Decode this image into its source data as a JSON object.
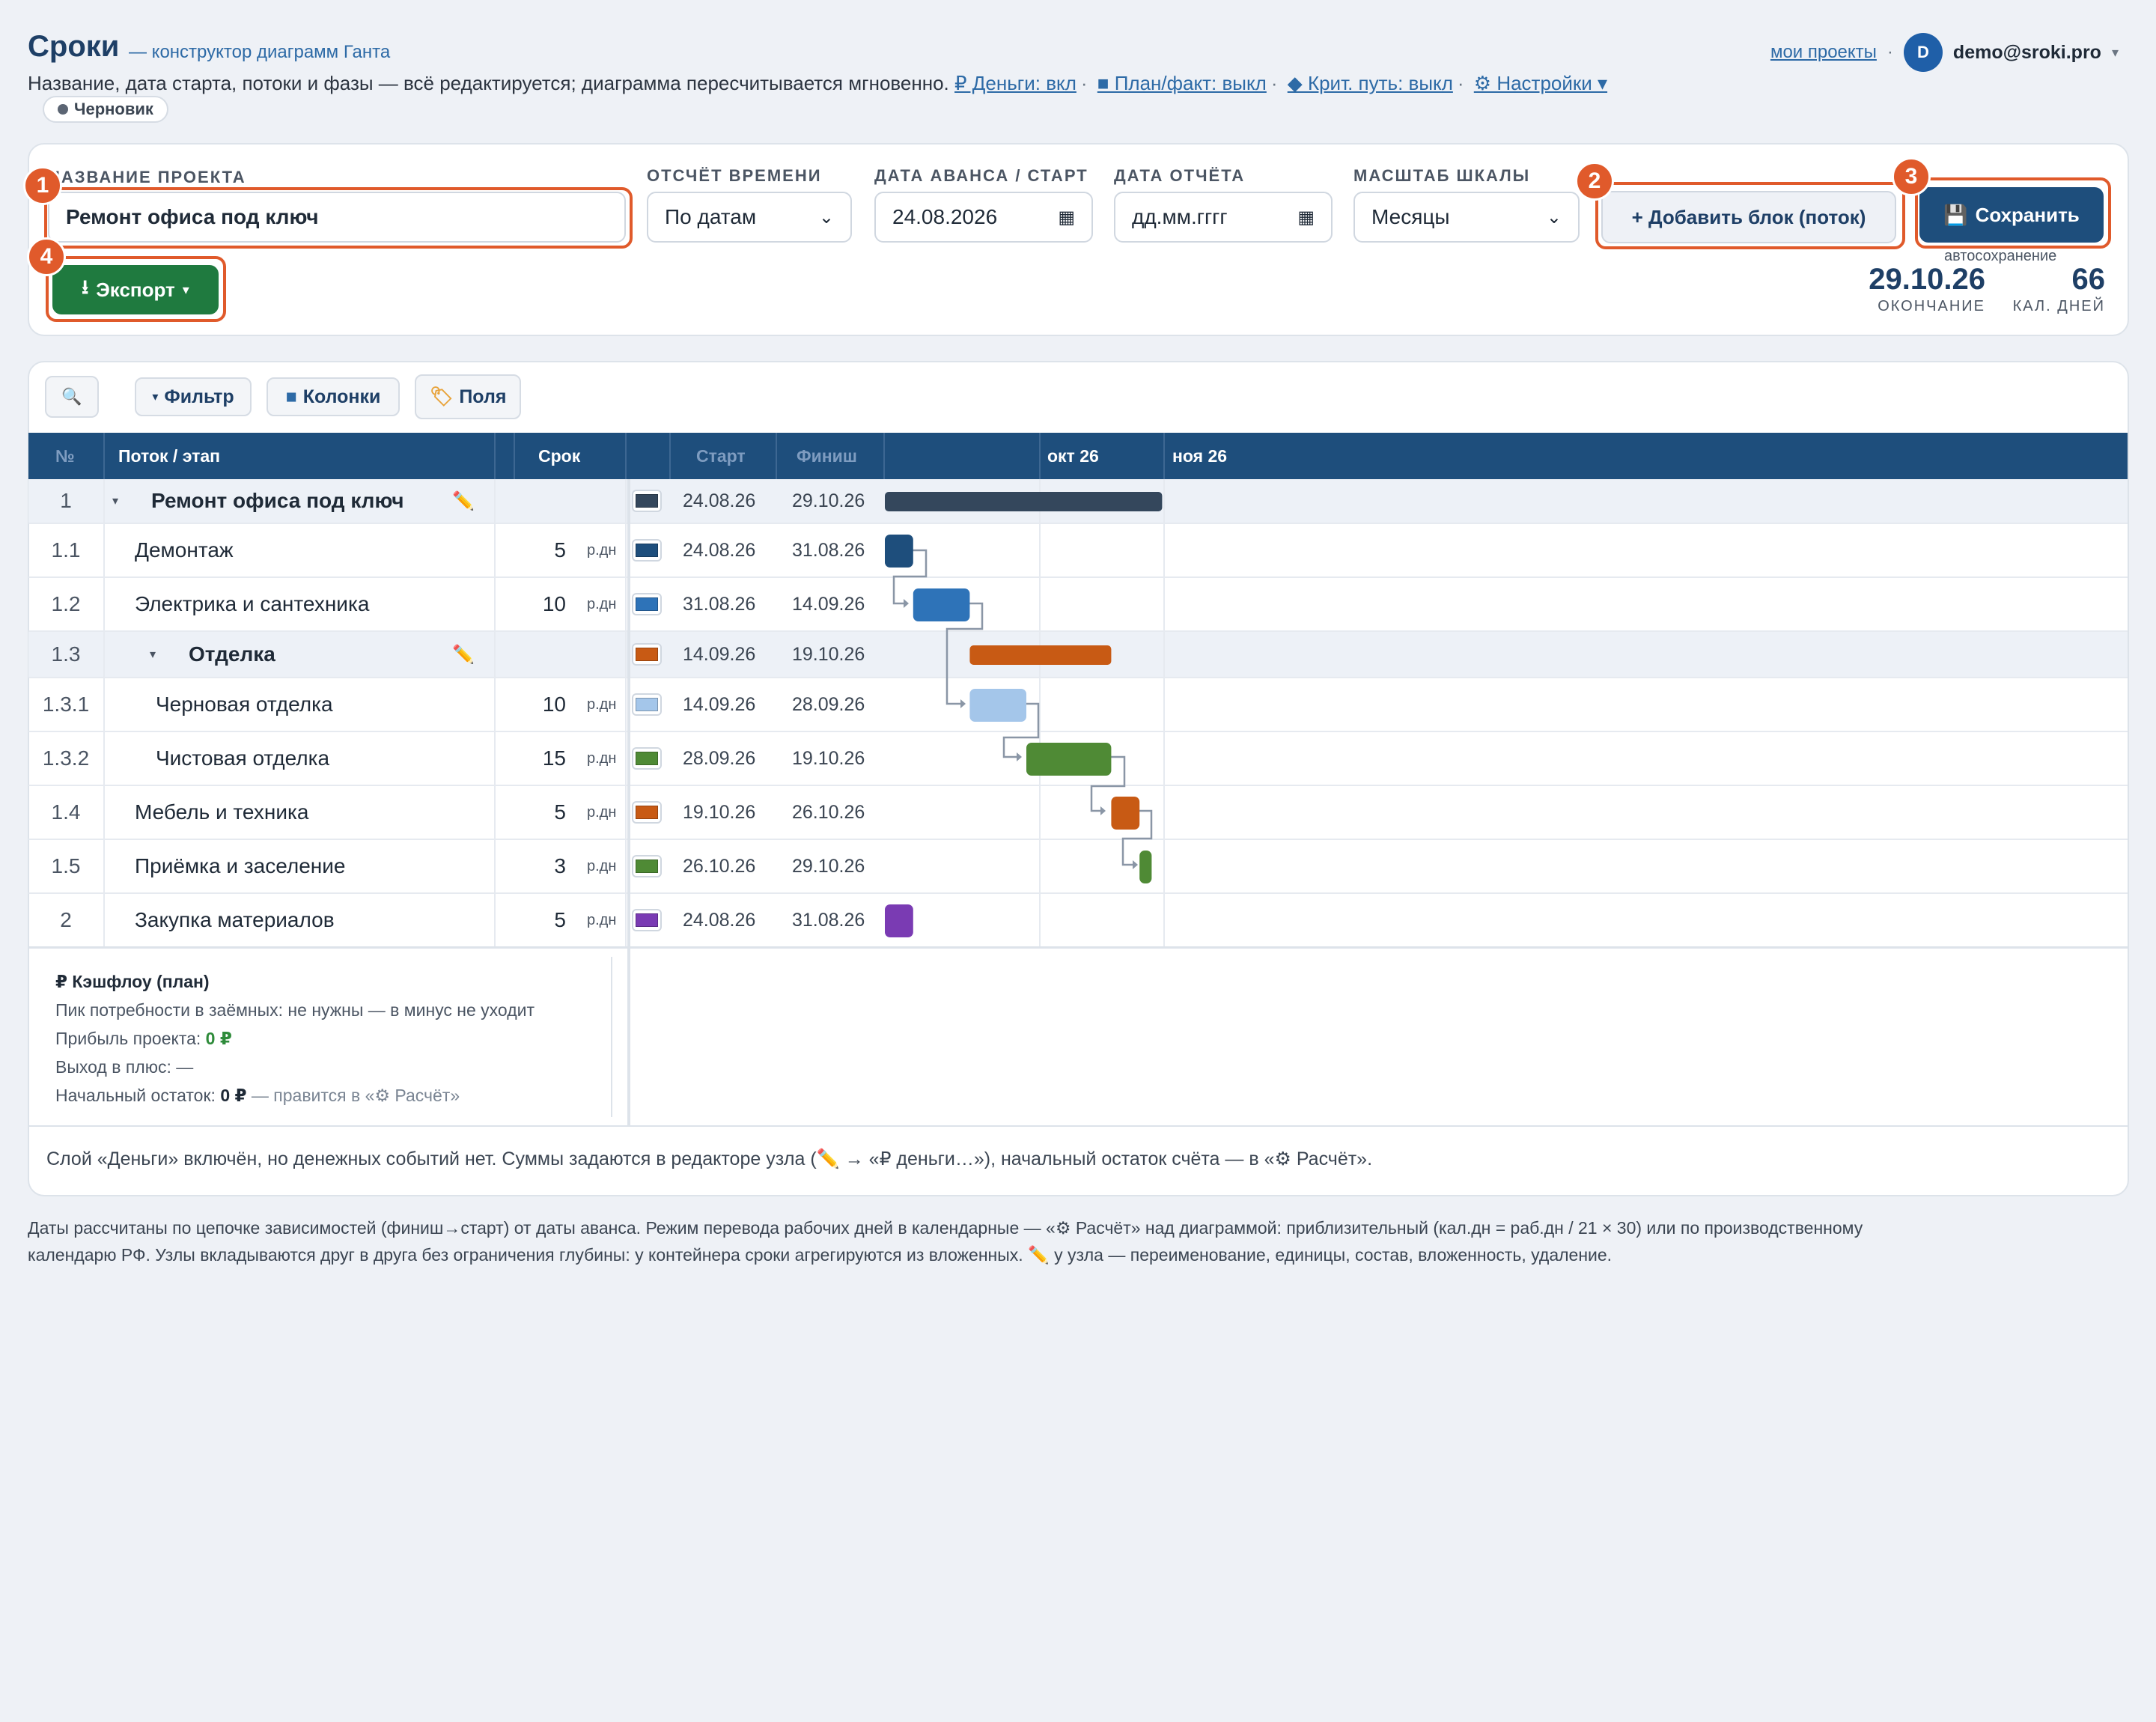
{
  "header": {
    "title": "Сроки",
    "subtitle": "— конструктор диаграмм Ганта",
    "description": "Название, дата старта, потоки и фазы — всё редактируется; диаграмма пересчитывается мгновенно.",
    "toggles": [
      "₽ Деньги: вкл",
      "■ План/факт: выкл",
      "◆ Крит. путь: выкл",
      "⚙ Настройки ▾"
    ],
    "status": "Черновик",
    "my_projects": "мои проекты",
    "avatar_letter": "D",
    "email": "demo@sroki.pro"
  },
  "controls": {
    "project_name_label": "НАЗВАНИЕ ПРОЕКТА",
    "project_name": "Ремонт офиса под ключ",
    "time_label": "ОТСЧЁТ ВРЕМЕНИ",
    "time_value": "По датам",
    "start_label": "ДАТА АВАНСА / СТАРТ",
    "start_value": "24.08.2026",
    "report_label": "ДАТА ОТЧЁТА",
    "report_value": "дд.мм.гггг",
    "scale_label": "МАСШТАБ ШКАЛЫ",
    "scale_value": "Месяцы",
    "add_block": "+ Добавить блок (поток)",
    "save": "Сохранить",
    "autosave": "автосохранение",
    "export": "Экспорт",
    "end_date": "29.10.26",
    "end_label": "ОКОНЧАНИЕ",
    "days": "66",
    "days_label": "КАЛ. ДНЕЙ"
  },
  "toolbar": {
    "filter": "Фильтр",
    "columns": "Колонки",
    "fields": "Поля"
  },
  "table": {
    "headers": {
      "num": "№",
      "name": "Поток / этап",
      "duration": "Срок",
      "start": "Старт",
      "finish": "Финиш",
      "month1": "окт 26",
      "month2": "ноя 26"
    },
    "rows": [
      {
        "num": "1",
        "name": "Ремонт офиса под ключ",
        "dur": "",
        "unit": "",
        "start": "24.08.26",
        "finish": "29.10.26",
        "color": "#34475c"
      },
      {
        "num": "1.1",
        "name": "Демонтаж",
        "dur": "5",
        "unit": "р.дн",
        "start": "24.08.26",
        "finish": "31.08.26",
        "color": "#1e4e7c"
      },
      {
        "num": "1.2",
        "name": "Электрика и сантехника",
        "dur": "10",
        "unit": "р.дн",
        "start": "31.08.26",
        "finish": "14.09.26",
        "color": "#2e73b8"
      },
      {
        "num": "1.3",
        "name": "Отделка",
        "dur": "",
        "unit": "",
        "start": "14.09.26",
        "finish": "19.10.26",
        "color": "#c85a14"
      },
      {
        "num": "1.3.1",
        "name": "Черновая отделка",
        "dur": "10",
        "unit": "р.дн",
        "start": "14.09.26",
        "finish": "28.09.26",
        "color": "#a4c6ea"
      },
      {
        "num": "1.3.2",
        "name": "Чистовая отделка",
        "dur": "15",
        "unit": "р.дн",
        "start": "28.09.26",
        "finish": "19.10.26",
        "color": "#4f8a35"
      },
      {
        "num": "1.4",
        "name": "Мебель и техника",
        "dur": "5",
        "unit": "р.дн",
        "start": "19.10.26",
        "finish": "26.10.26",
        "color": "#c85a14"
      },
      {
        "num": "1.5",
        "name": "Приёмка и заселение",
        "dur": "3",
        "unit": "р.дн",
        "start": "26.10.26",
        "finish": "29.10.26",
        "color": "#4f8a35"
      },
      {
        "num": "2",
        "name": "Закупка материалов",
        "dur": "5",
        "unit": "р.дн",
        "start": "24.08.26",
        "finish": "31.08.26",
        "color": "#7a3bb3"
      }
    ]
  },
  "cashflow": {
    "title": "₽ Кэшфлоу (план)",
    "peak": "Пик потребности в заёмных: не нужны — в минус не уходит",
    "profit_label": "Прибыль проекта:",
    "profit_value": "0 ₽",
    "breakeven": "Выход в плюс: —",
    "balance_label": "Начальный остаток:",
    "balance_value": "0 ₽",
    "balance_note": "— правится в «⚙ Расчёт»"
  },
  "money_note": "Слой «Деньги» включён, но денежных событий нет. Суммы задаются в редакторе узла (✏️ → «₽ деньги…»), начальный остаток счёта — в «⚙ Расчёт».",
  "footer_line1": "Даты рассчитаны по цепочке зависимостей (финиш→старт) от даты аванса. Режим перевода рабочих дней в календарные — «⚙ Расчёт» над диаграммой: приблизительный (кал.дн = раб.дн / 21 × 30) или по производственному",
  "footer_line2": "календарю РФ. Узлы вкладываются друг в друга без ограничения глубины: у контейнера сроки агрегируются из вложенных. ✏️ у узла — переименование, единицы, состав, вложенность, удаление.",
  "annotations": [
    "1",
    "2",
    "3",
    "4"
  ]
}
